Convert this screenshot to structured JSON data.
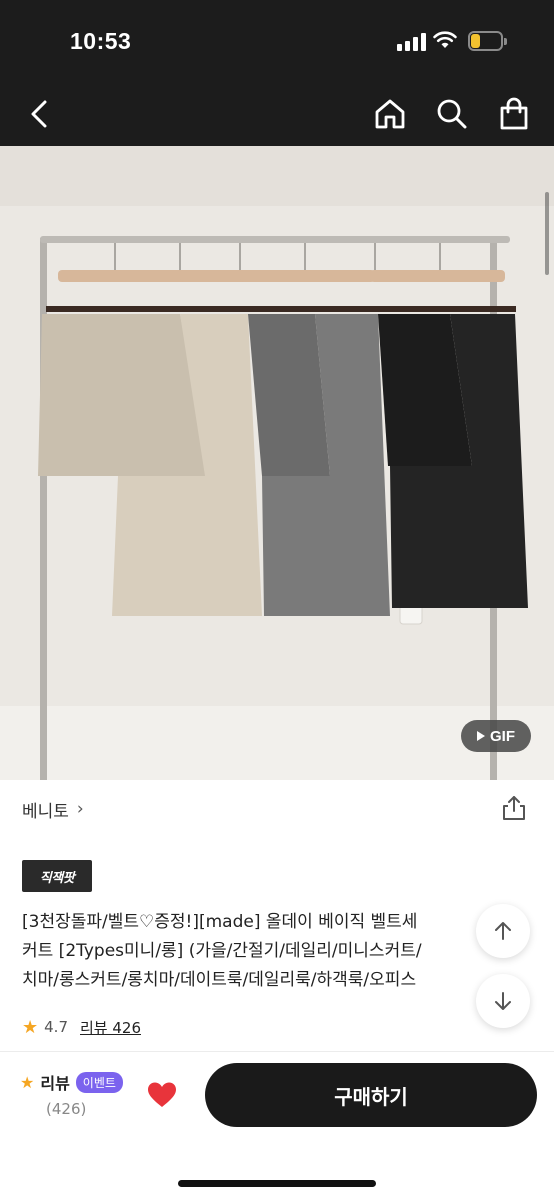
{
  "status_bar": {
    "time": "10:53"
  },
  "nav": {
    "back_icon": "chevron-left-icon",
    "home_icon": "home-icon",
    "search_icon": "search-icon",
    "bag_icon": "shopping-bag-icon"
  },
  "media": {
    "gif_label": "GIF"
  },
  "product": {
    "brand": "베니토",
    "brand_chevron": "›",
    "tag": "직잭팟",
    "title_lines": [
      "[3천장돌파/벨트♡증정!][made] 올데이 베이직 벨트세",
      "커트 [2Types미니/롱] (가을/간절기/데일리/미니스커트/",
      "치마/롱스커트/롱치마/데이트룩/데일리룩/하객룩/오피스"
    ],
    "rating": "4.7",
    "review_link": "리뷰 426"
  },
  "bottom_bar": {
    "review_label": "리뷰",
    "event_badge": "이벤트",
    "review_count": "(426)",
    "buy_label": "구매하기"
  },
  "colors": {
    "dark": "#1c1c1c",
    "star": "#f5a623",
    "event": "#7b63ee",
    "heart": "#e8343b"
  }
}
